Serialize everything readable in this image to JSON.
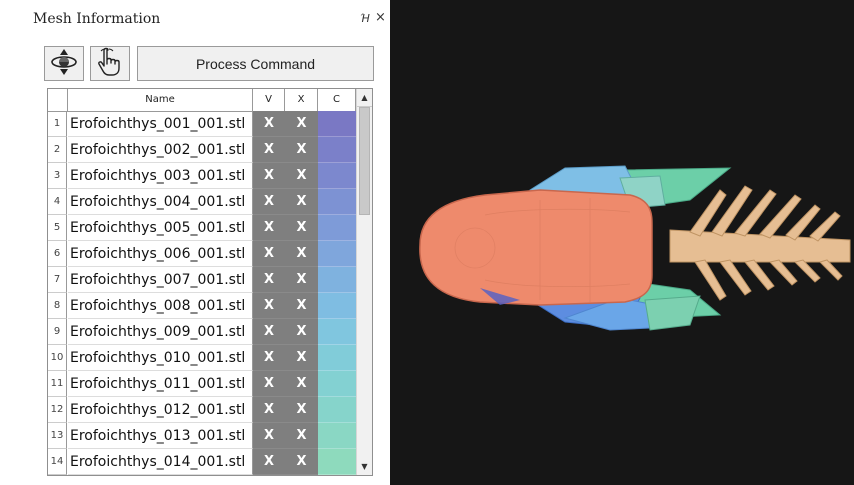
{
  "panel": {
    "title": "Mesh Information",
    "float_icon": "float-icon",
    "close_icon": "close-icon",
    "float_glyph": "Ή",
    "close_glyph": "×"
  },
  "toolbar": {
    "rotate_icon": "rotate-view-icon",
    "pick_icon": "hand-pointer-icon",
    "process_label": "Process Command"
  },
  "table": {
    "headers": {
      "name": "Name",
      "v": "V",
      "x": "X",
      "c": "C"
    },
    "rows": [
      {
        "num": "1",
        "name": "Erofoichthys_001_001.stl",
        "v": "X",
        "x": "X",
        "color": "#7a78c4"
      },
      {
        "num": "2",
        "name": "Erofoichthys_002_001.stl",
        "v": "X",
        "x": "X",
        "color": "#7b80c9"
      },
      {
        "num": "3",
        "name": "Erofoichthys_003_001.stl",
        "v": "X",
        "x": "X",
        "color": "#7c88ce"
      },
      {
        "num": "4",
        "name": "Erofoichthys_004_001.stl",
        "v": "X",
        "x": "X",
        "color": "#7d92d3"
      },
      {
        "num": "5",
        "name": "Erofoichthys_005_001.stl",
        "v": "X",
        "x": "X",
        "color": "#7e9bd8"
      },
      {
        "num": "6",
        "name": "Erofoichthys_006_001.stl",
        "v": "X",
        "x": "X",
        "color": "#7fa6dc"
      },
      {
        "num": "7",
        "name": "Erofoichthys_007_001.stl",
        "v": "X",
        "x": "X",
        "color": "#7fb2df"
      },
      {
        "num": "8",
        "name": "Erofoichthys_008_001.stl",
        "v": "X",
        "x": "X",
        "color": "#7fbde2"
      },
      {
        "num": "9",
        "name": "Erofoichthys_009_001.stl",
        "v": "X",
        "x": "X",
        "color": "#80c6df"
      },
      {
        "num": "10",
        "name": "Erofoichthys_010_001.stl",
        "v": "X",
        "x": "X",
        "color": "#81ccd9"
      },
      {
        "num": "11",
        "name": "Erofoichthys_011_001.stl",
        "v": "X",
        "x": "X",
        "color": "#83d1d2"
      },
      {
        "num": "12",
        "name": "Erofoichthys_012_001.stl",
        "v": "X",
        "x": "X",
        "color": "#86d4cb"
      },
      {
        "num": "13",
        "name": "Erofoichthys_013_001.stl",
        "v": "X",
        "x": "X",
        "color": "#8ad7c4"
      },
      {
        "num": "14",
        "name": "Erofoichthys_014_001.stl",
        "v": "X",
        "x": "X",
        "color": "#8edabd"
      }
    ],
    "scroll_up_icon": "scroll-up-arrow-icon",
    "scroll_down_icon": "scroll-down-arrow-icon"
  },
  "viewport": {
    "name": "3d-mesh-viewport",
    "background": "#161616"
  }
}
